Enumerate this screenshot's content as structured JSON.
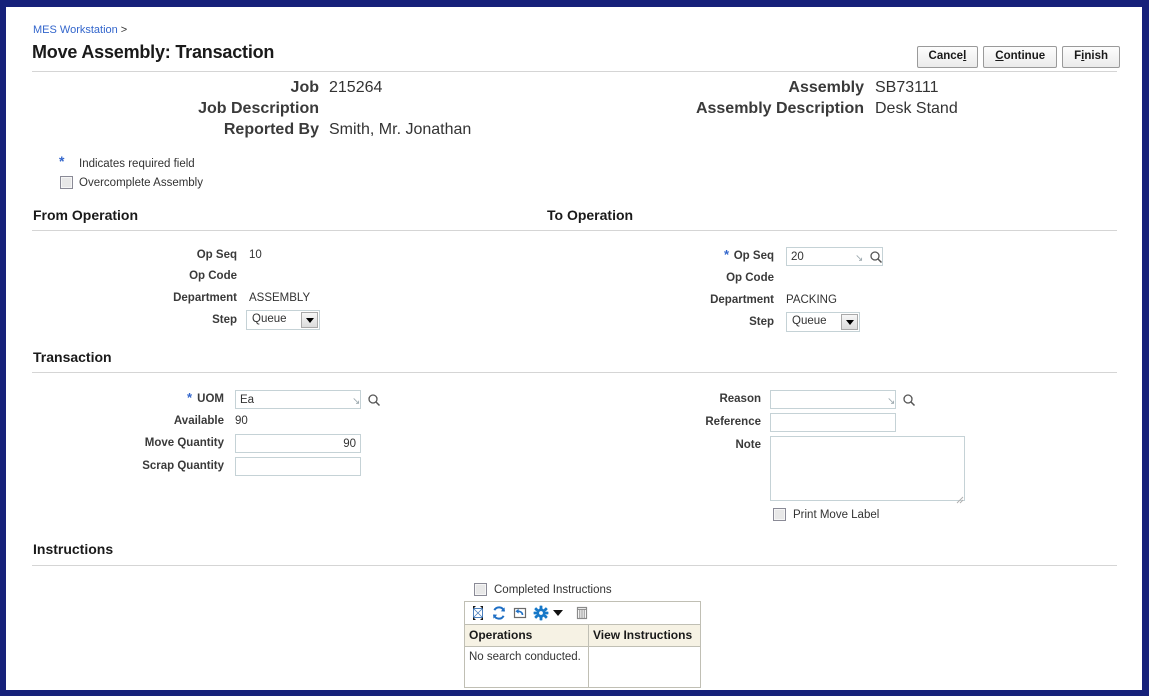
{
  "window": {
    "frame_color": "#16217a"
  },
  "header": {
    "breadcrumb_link": "MES Workstation",
    "breadcrumb_separator": ">",
    "title": "Move Assembly: Transaction",
    "buttons": [
      {
        "label": "Cancel",
        "accesskey_index": 5
      },
      {
        "label": "Continue",
        "accesskey_index": 0
      },
      {
        "label": "Finish",
        "accesskey_index": 1
      }
    ]
  },
  "summary": {
    "left": [
      {
        "label": "Job",
        "value": "215264"
      },
      {
        "label": "Job Description",
        "value": ""
      },
      {
        "label": "Reported By",
        "value": "Smith, Mr. Jonathan"
      }
    ],
    "right": [
      {
        "label": "Assembly",
        "value": "SB73111"
      },
      {
        "label": "Assembly Description",
        "value": "Desk Stand"
      }
    ]
  },
  "legend": {
    "required_symbol": "*",
    "required_text": "Indicates required field",
    "overcomplete_label": "Overcomplete Assembly",
    "overcomplete_checked": false,
    "required_color": "#3366cc"
  },
  "from_operation": {
    "section_title": "From Operation",
    "op_seq_label": "Op Seq",
    "op_seq_value": "10",
    "op_code_label": "Op Code",
    "op_code_value": "",
    "department_label": "Department",
    "department_value": "ASSEMBLY",
    "step_label": "Step",
    "step_value": "Queue"
  },
  "to_operation": {
    "section_title": "To Operation",
    "op_seq_label": "Op Seq",
    "op_seq_value": "20",
    "op_seq_required": "*",
    "op_code_label": "Op Code",
    "op_code_value": "",
    "department_label": "Department",
    "department_value": "PACKING",
    "step_label": "Step",
    "step_value": "Queue"
  },
  "transaction": {
    "section_title": "Transaction",
    "uom_label": "UOM",
    "uom_required": "*",
    "uom_value": "Ea",
    "available_label": "Available",
    "available_value": "90",
    "move_quantity_label": "Move Quantity",
    "move_quantity_value": "90",
    "scrap_quantity_label": "Scrap Quantity",
    "scrap_quantity_value": "",
    "reason_label": "Reason",
    "reason_value": "",
    "reference_label": "Reference",
    "reference_value": "",
    "note_label": "Note",
    "note_value": "",
    "print_move_label": "Print Move Label",
    "print_move_checked": false
  },
  "instructions": {
    "section_title": "Instructions",
    "completed_label": "Completed Instructions",
    "completed_checked": false,
    "toolbar_icons": [
      "detach-icon",
      "refresh-icon",
      "export-icon",
      "gear-icon",
      "freeze-columns-icon"
    ],
    "columns": [
      "Operations",
      "View Instructions"
    ],
    "empty_message": "No search conducted.",
    "rows": []
  }
}
